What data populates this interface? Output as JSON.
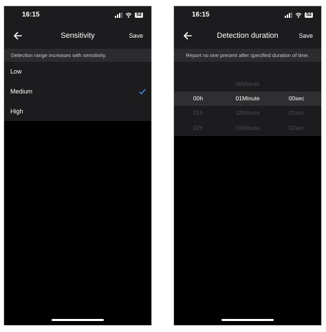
{
  "left_screen": {
    "status_time": "16:15",
    "battery": "52",
    "title": "Sensitivity",
    "save_label": "Save",
    "description": "Detection range increases with sensitivity.",
    "options": [
      "Low",
      "Medium",
      "High"
    ],
    "selected_option": "Medium",
    "accent_color": "#4a9ff5"
  },
  "right_screen": {
    "status_time": "16:15",
    "battery": "52",
    "title": "Detection duration",
    "save_label": "Save",
    "description": "Report no one present after specified duration of time.",
    "picker": {
      "rows": [
        {
          "hours": "",
          "minutes": "00Minute",
          "seconds": ""
        },
        {
          "hours": "00h",
          "minutes": "01Minute",
          "seconds": "00sec"
        },
        {
          "hours": "01h",
          "minutes": "02Minute",
          "seconds": "01sec"
        },
        {
          "hours": "02h",
          "minutes": "03Minute",
          "seconds": "02sec"
        }
      ],
      "selected": {
        "hours": "00h",
        "minutes": "01Minute",
        "seconds": "00sec"
      }
    }
  }
}
